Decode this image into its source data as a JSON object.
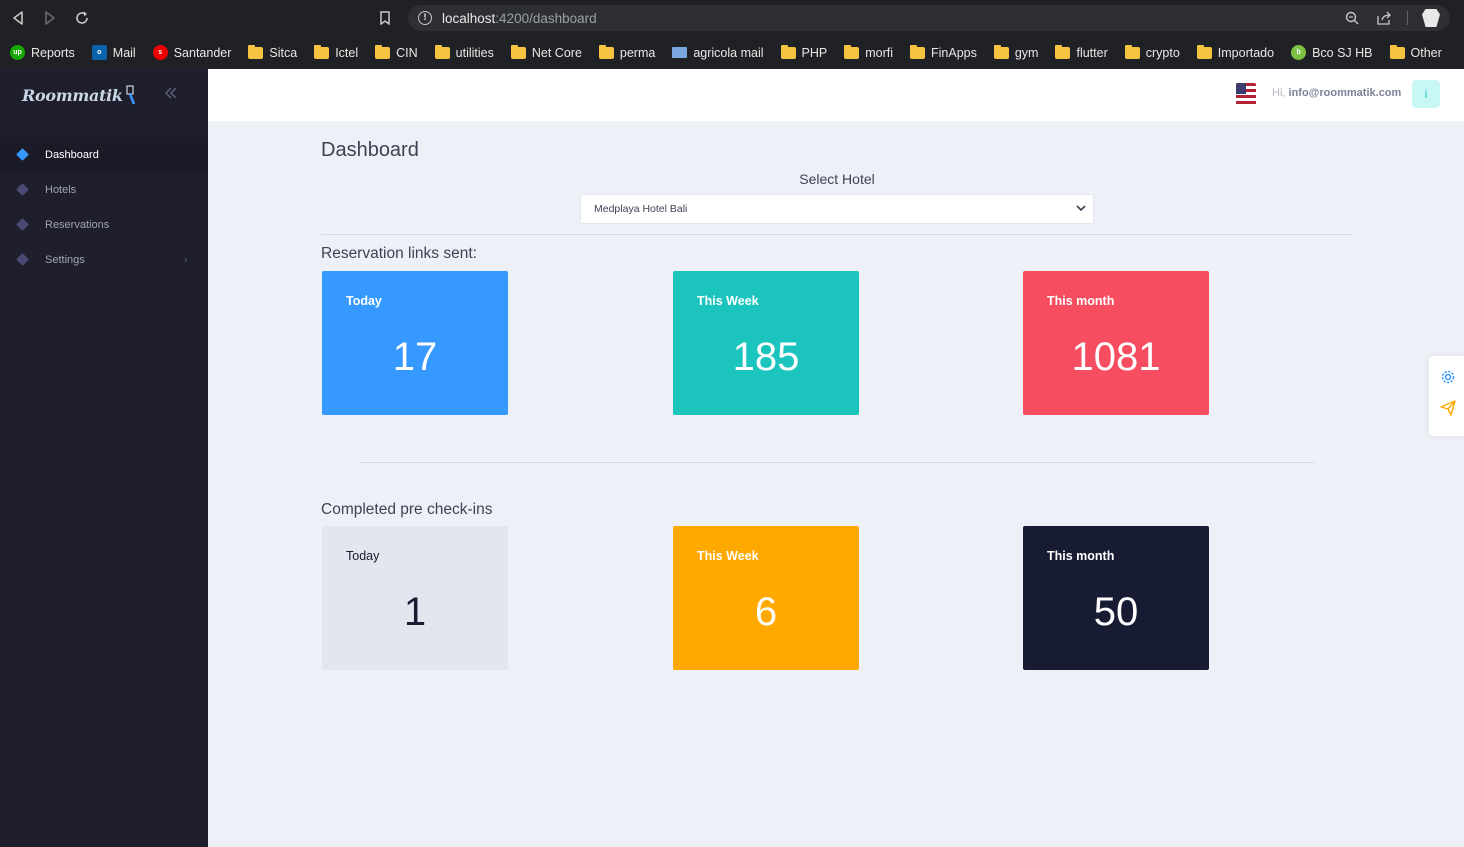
{
  "browser": {
    "url_host": "localhost",
    "url_path": ":4200/dashboard",
    "bookmarks": [
      {
        "label": "Reports",
        "icon": "upwork-icon"
      },
      {
        "label": "Mail",
        "icon": "outlook-icon"
      },
      {
        "label": "Santander",
        "icon": "santander-icon"
      },
      {
        "label": "Sitca",
        "icon": "folder-icon"
      },
      {
        "label": "Ictel",
        "icon": "folder-icon"
      },
      {
        "label": "CIN",
        "icon": "folder-icon"
      },
      {
        "label": "utilities",
        "icon": "folder-icon"
      },
      {
        "label": "Net Core",
        "icon": "folder-icon"
      },
      {
        "label": "perma",
        "icon": "folder-icon"
      },
      {
        "label": "agricola mail",
        "icon": "mail-icon"
      },
      {
        "label": "PHP",
        "icon": "folder-icon"
      },
      {
        "label": "morfi",
        "icon": "folder-icon"
      },
      {
        "label": "FinApps",
        "icon": "folder-icon"
      },
      {
        "label": "gym",
        "icon": "folder-icon"
      },
      {
        "label": "flutter",
        "icon": "folder-icon"
      },
      {
        "label": "crypto",
        "icon": "folder-icon"
      },
      {
        "label": "Importado",
        "icon": "folder-icon"
      },
      {
        "label": "Bco SJ HB",
        "icon": "bank-icon"
      },
      {
        "label": "Other",
        "icon": "folder-icon"
      }
    ]
  },
  "sidebar": {
    "logo": "Roommatik",
    "items": [
      {
        "label": "Dashboard",
        "active": true
      },
      {
        "label": "Hotels",
        "active": false
      },
      {
        "label": "Reservations",
        "active": false
      },
      {
        "label": "Settings",
        "active": false,
        "has_submenu": true
      }
    ]
  },
  "header": {
    "greeting": "Hi,",
    "email": "info@roommatik.com",
    "avatar_letter": "i"
  },
  "main": {
    "title": "Dashboard",
    "select_label": "Select Hotel",
    "selected_hotel": "Medplaya Hotel Bali",
    "sections": [
      {
        "title": "Reservation links sent:",
        "cards": [
          {
            "label": "Today",
            "value": "17",
            "bg": "#3699ff",
            "fg": "#ffffff"
          },
          {
            "label": "This Week",
            "value": "185",
            "bg": "#1bc5bd",
            "fg": "#ffffff"
          },
          {
            "label": "This month",
            "value": "1081",
            "bg": "#f64e60",
            "fg": "#ffffff"
          }
        ]
      },
      {
        "title": "Completed pre check-ins",
        "cards": [
          {
            "label": "Today",
            "value": "1",
            "bg": "#e4e6ef",
            "fg": "#181c32"
          },
          {
            "label": "This Week",
            "value": "6",
            "bg": "#ffa800",
            "fg": "#ffffff"
          },
          {
            "label": "This month",
            "value": "50",
            "bg": "#181c32",
            "fg": "#ffffff"
          }
        ]
      }
    ]
  },
  "float_toolbar": {
    "icons": [
      "gear-icon",
      "paper-plane-icon"
    ],
    "colors": [
      "#3699ff",
      "#ffa800"
    ]
  }
}
